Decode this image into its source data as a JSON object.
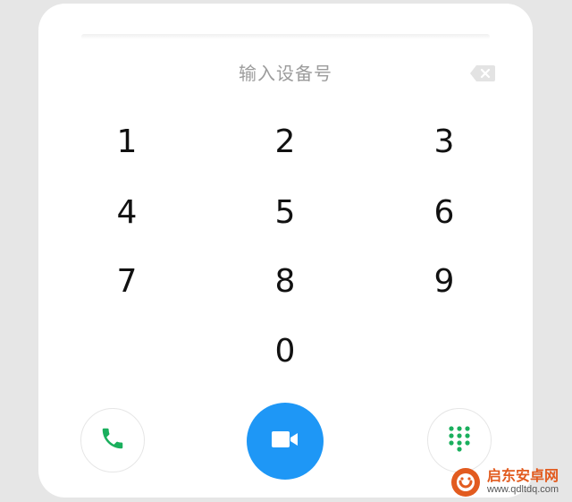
{
  "dialer": {
    "placeholder": "输入设备号",
    "keys": [
      "1",
      "2",
      "3",
      "4",
      "5",
      "6",
      "7",
      "8",
      "9",
      "0"
    ]
  },
  "icons": {
    "backspace": "backspace-icon",
    "call": "phone-icon",
    "video": "video-camera-icon",
    "keypad": "dialpad-icon"
  },
  "colors": {
    "call_green": "#1aaf5d",
    "video_blue": "#1e97f6",
    "keypad_green": "#1aaf5d"
  },
  "watermark": {
    "title": "启东安卓网",
    "url": "www.qdltdq.com"
  }
}
